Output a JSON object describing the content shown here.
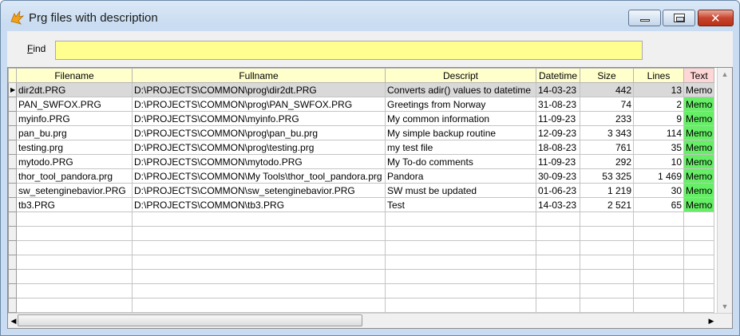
{
  "window": {
    "title": "Prg files with description"
  },
  "find": {
    "label_prefix": "F",
    "label_rest": "ind",
    "value": ""
  },
  "columns": [
    "Filename",
    "Fullname",
    "Descript",
    "Datetime",
    "Size",
    "Lines",
    "Text"
  ],
  "rows": [
    {
      "filename": "dir2dt.PRG",
      "fullname": "D:\\PROJECTS\\COMMON\\prog\\dir2dt.PRG",
      "descript": "Converts adir() values to datetime",
      "datetime": "14-03-23",
      "size": "442",
      "lines": "13",
      "text": "Memo"
    },
    {
      "filename": "PAN_SWFOX.PRG",
      "fullname": "D:\\PROJECTS\\COMMON\\prog\\PAN_SWFOX.PRG",
      "descript": "Greetings from Norway",
      "datetime": "31-08-23",
      "size": "74",
      "lines": "2",
      "text": "Memo"
    },
    {
      "filename": "myinfo.PRG",
      "fullname": "D:\\PROJECTS\\COMMON\\myinfo.PRG",
      "descript": "My common information",
      "datetime": "11-09-23",
      "size": "233",
      "lines": "9",
      "text": "Memo"
    },
    {
      "filename": "pan_bu.prg",
      "fullname": "D:\\PROJECTS\\COMMON\\prog\\pan_bu.prg",
      "descript": "My simple backup routine",
      "datetime": "12-09-23",
      "size": "3 343",
      "lines": "114",
      "text": "Memo"
    },
    {
      "filename": "testing.prg",
      "fullname": "D:\\PROJECTS\\COMMON\\prog\\testing.prg",
      "descript": "my test file",
      "datetime": "18-08-23",
      "size": "761",
      "lines": "35",
      "text": "Memo"
    },
    {
      "filename": "mytodo.PRG",
      "fullname": "D:\\PROJECTS\\COMMON\\mytodo.PRG",
      "descript": "My To-do comments",
      "datetime": "11-09-23",
      "size": "292",
      "lines": "10",
      "text": "Memo"
    },
    {
      "filename": "thor_tool_pandora.prg",
      "fullname": "D:\\PROJECTS\\COMMON\\My Tools\\thor_tool_pandora.prg",
      "descript": "Pandora",
      "datetime": "30-09-23",
      "size": "53 325",
      "lines": "1 469",
      "text": "Memo"
    },
    {
      "filename": "sw_setenginebavior.PRG",
      "fullname": "D:\\PROJECTS\\COMMON\\sw_setenginebavior.PRG",
      "descript": "SW must be updated",
      "datetime": "01-06-23",
      "size": "1 219",
      "lines": "30",
      "text": "Memo"
    },
    {
      "filename": "tb3.PRG",
      "fullname": "D:\\PROJECTS\\COMMON\\tb3.PRG",
      "descript": "Test",
      "datetime": "14-03-23",
      "size": "2 521",
      "lines": "65",
      "text": "Memo"
    }
  ],
  "empty_rows": 7,
  "colors": {
    "find_bg": "#ffff90",
    "header_bg": "#ffffcc",
    "text_header_bg": "#ffd6d6",
    "memo_bg": "#66ee66",
    "current_row_bg": "#d9d9d9"
  }
}
